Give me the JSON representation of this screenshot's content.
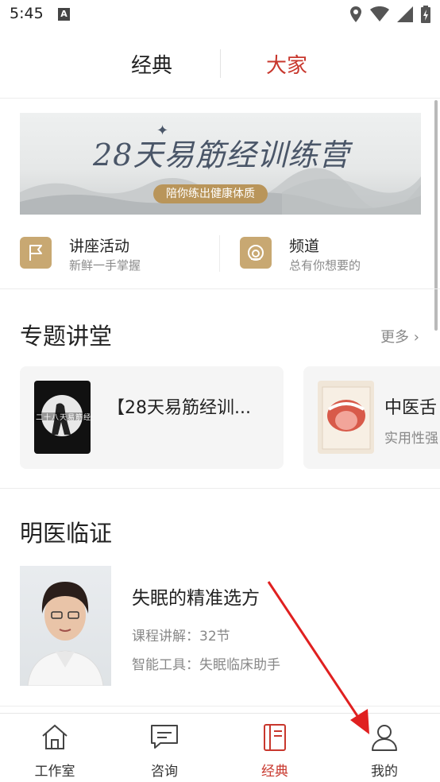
{
  "status_bar": {
    "time": "5:45",
    "notification_icon_letter": "A"
  },
  "top_tabs": {
    "classic": "经典",
    "master": "大家",
    "active": "master"
  },
  "banner": {
    "title": "28天易筋经训练营",
    "tagline": "陪你练出健康体质"
  },
  "entries": [
    {
      "title": "讲座活动",
      "subtitle": "新鲜一手掌握",
      "icon": "flag-icon"
    },
    {
      "title": "频道",
      "subtitle": "总有你想要的",
      "icon": "channel-icon"
    }
  ],
  "lectures": {
    "title": "专题讲堂",
    "more": "更多",
    "cards": [
      {
        "title": "【28天易筋经训...",
        "subtitle": "",
        "thumb_text": "二十八天易筋经"
      },
      {
        "title": "中医舌",
        "subtitle": "实用性强"
      }
    ]
  },
  "clinic": {
    "title": "明医临证",
    "item": {
      "title": "失眠的精准选方",
      "course": "课程讲解：32节",
      "tool": "智能工具：失眠临床助手"
    }
  },
  "bottom_nav": [
    {
      "label": "工作室",
      "icon": "home-icon"
    },
    {
      "label": "咨询",
      "icon": "chat-icon"
    },
    {
      "label": "经典",
      "icon": "book-icon",
      "active": true
    },
    {
      "label": "我的",
      "icon": "profile-icon"
    }
  ],
  "colors": {
    "accent": "#c8372d",
    "gold": "#c8a872",
    "annotation": "#e02020"
  }
}
